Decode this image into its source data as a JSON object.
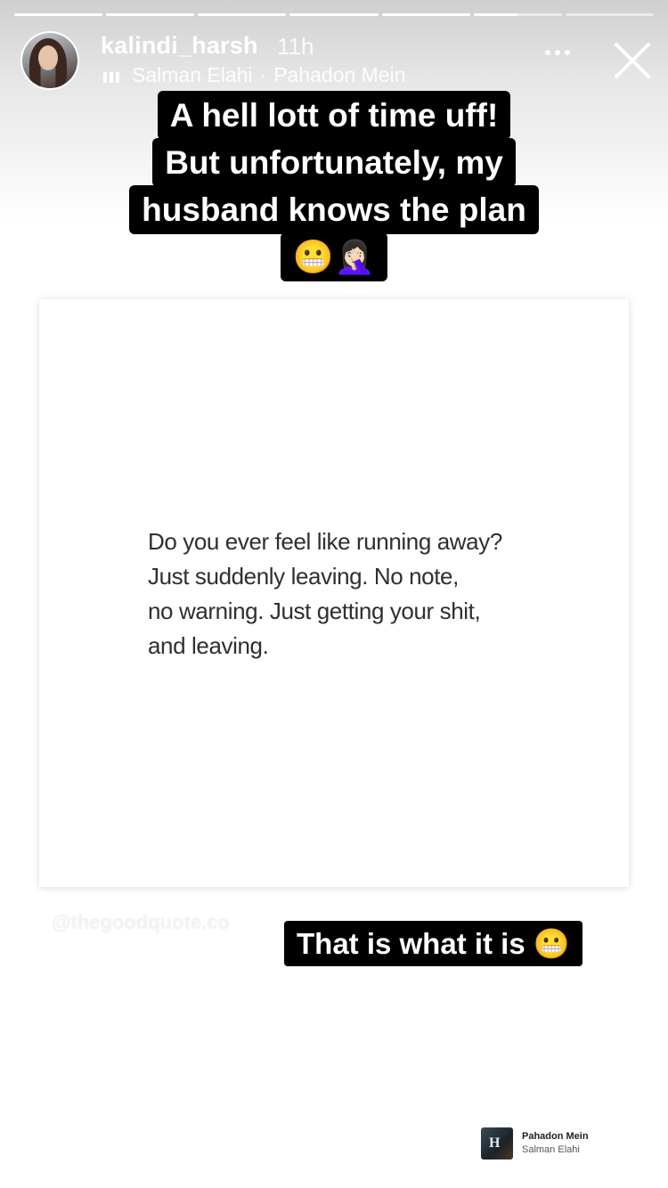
{
  "story": {
    "progress_segments": [
      1,
      1,
      1,
      1,
      1,
      0.5,
      0
    ],
    "username": "kalindi_harsh",
    "time_ago": "11h",
    "music": {
      "artist": "Salman Elahi",
      "separator": "·",
      "song": "Pahadon Mein"
    }
  },
  "caption_top": {
    "lines": [
      "A hell lott of time uff!",
      "But unfortunately, my",
      "husband knows the plan",
      "😬🤦🏻‍♀️"
    ]
  },
  "quote_card": {
    "lines": [
      "Do you ever feel like running away?",
      "Just suddenly leaving. No note,",
      "no warning. Just getting your shit,",
      "and leaving."
    ]
  },
  "watermark": "@thegoodquote.co",
  "caption_bottom": "That is what it is 😬",
  "music_sticker": {
    "title": "Pahadon Mein",
    "artist": "Salman Elahi",
    "art_glyph": "H"
  },
  "colors": {
    "caption_bg": "#000000",
    "caption_text": "#ffffff",
    "quote_text": "#2f2f2f"
  }
}
